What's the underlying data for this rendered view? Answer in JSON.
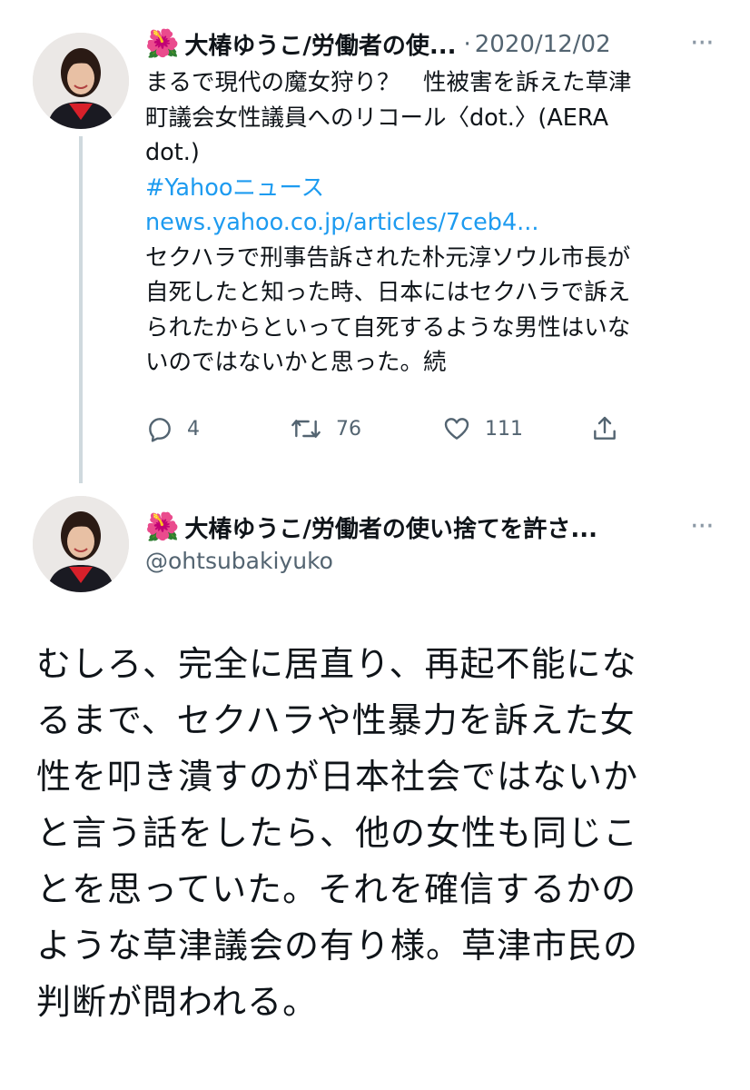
{
  "tweet1": {
    "author_flower": "🌺",
    "author_name": "大椿ゆうこ/労働者の使...",
    "separator": "·",
    "date": "2020/12/02",
    "more": "···",
    "text_lines": [
      "まるで現代の魔女狩り？　性被害を訴えた草津",
      "町議会女性議員へのリコール〈dot.〉(AERA",
      "dot.)"
    ],
    "hashtag": "#Yahooニュース",
    "link": "news.yahoo.co.jp/articles/7ceb4...",
    "continuation_lines": [
      "セクハラで刑事告訴された朴元淳ソウル市長が",
      "自死したと知った時、日本にはセクハラで訴え",
      "られたからといって自死するような男性はいな",
      "いのではないかと思った。続"
    ],
    "replies": "4",
    "retweets": "76",
    "likes": "111"
  },
  "tweet2": {
    "author_flower": "🌺",
    "author_name": "大椿ゆうこ/労働者の使い捨てを許さ...",
    "handle": "@ohtsubakiyuko",
    "more": "···",
    "text_lines": [
      "むしろ、完全に居直り、再起不能にな",
      "るまで、セクハラや性暴力を訴えた女",
      "性を叩き潰すのが日本社会ではないか",
      "と言う話をしたら、他の女性も同じこ",
      "とを思っていた。それを確信するかの",
      "ような草津議会の有り様。草津市民の",
      "判断が問われる。"
    ]
  },
  "colors": {
    "link": "#1d9bf0",
    "muted": "#536471",
    "thread_line": "#cfd9de"
  }
}
